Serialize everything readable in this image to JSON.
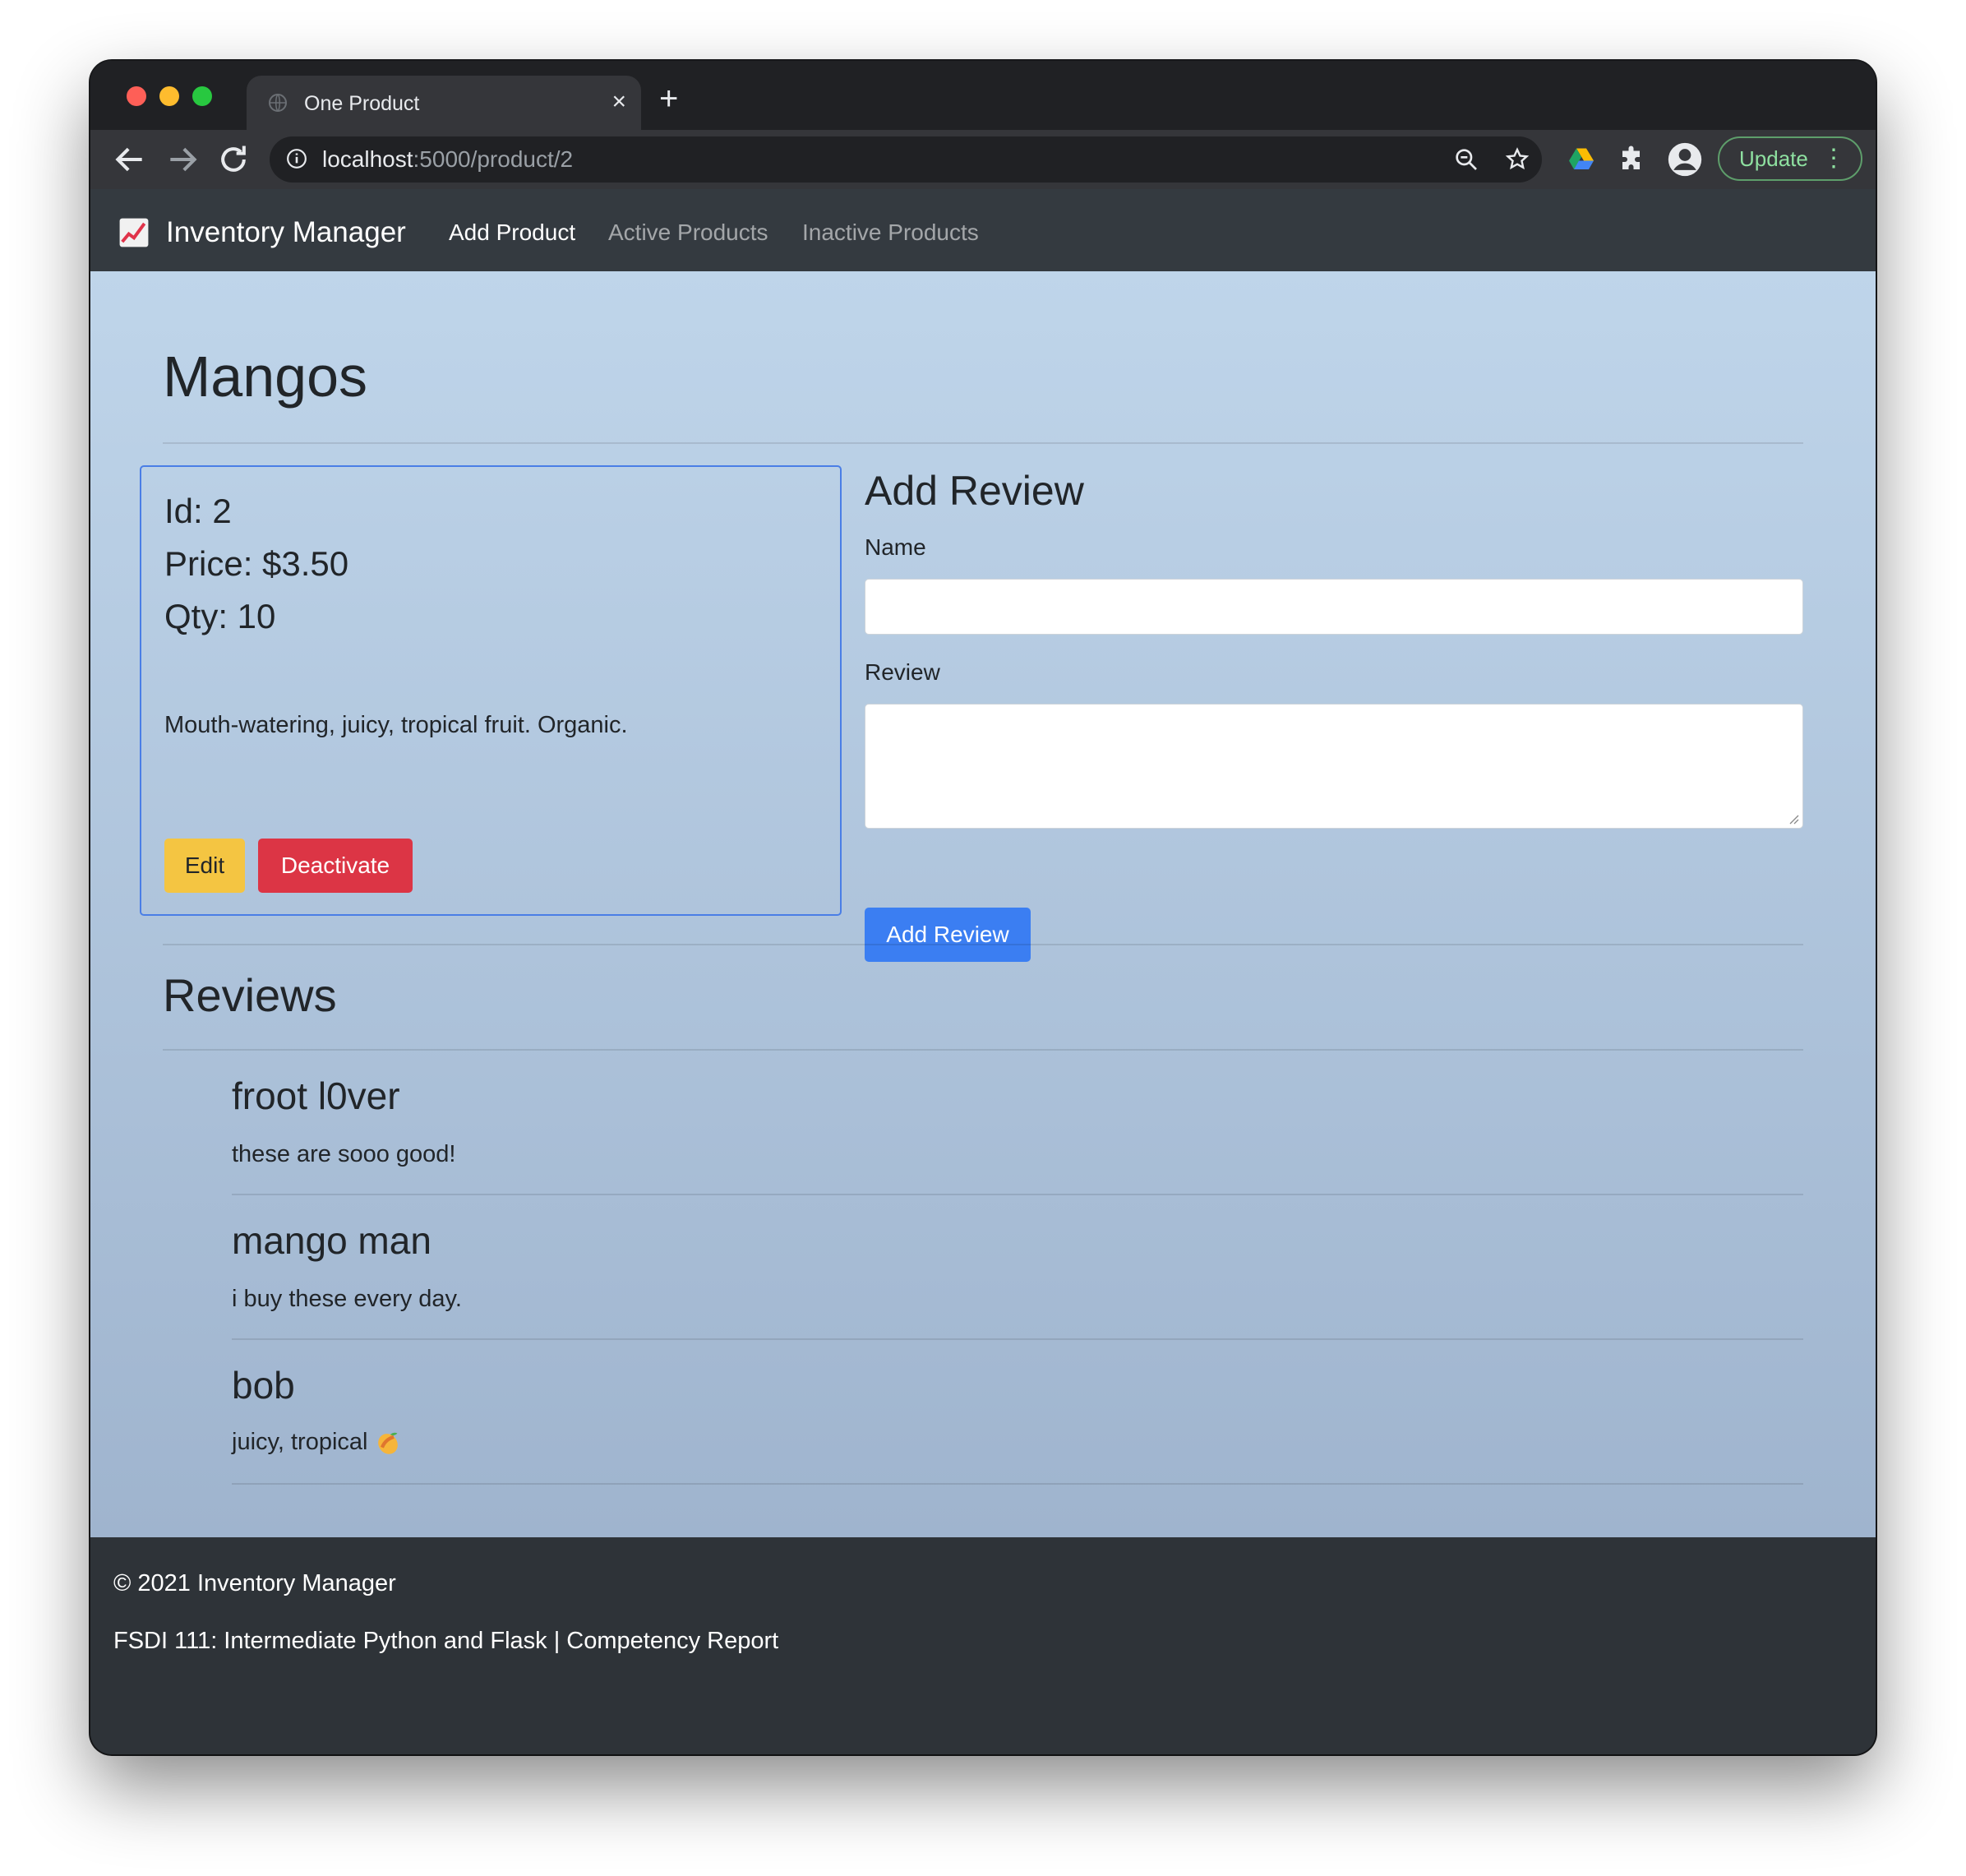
{
  "browser": {
    "tab_title": "One Product",
    "tab_close": "×",
    "new_tab": "+",
    "url_host": "localhost",
    "url_rest": ":5000/product/2",
    "update_label": "Update",
    "update_menu": "⋮"
  },
  "navbar": {
    "brand": "Inventory Manager",
    "links": [
      "Add Product",
      "Active Products",
      "Inactive Products"
    ]
  },
  "product": {
    "name": "Mangos",
    "id": "Id: 2",
    "price": "Price: $3.50",
    "qty": "Qty: 10",
    "description": "Mouth-watering, juicy, tropical fruit. Organic.",
    "edit_label": "Edit",
    "deactivate_label": "Deactivate"
  },
  "review_form": {
    "title": "Add Review",
    "name_label": "Name",
    "review_label": "Review",
    "submit_label": "Add Review"
  },
  "reviews": {
    "title": "Reviews",
    "items": [
      {
        "name": "froot l0ver",
        "text": "these are sooo good!"
      },
      {
        "name": "mango man",
        "text": "i buy these every day."
      },
      {
        "name": "bob",
        "text": "juicy, tropical"
      }
    ]
  },
  "footer": {
    "copyright": "© 2021 Inventory Manager",
    "course": "FSDI 111: Intermediate Python and Flask | Competency Report"
  }
}
